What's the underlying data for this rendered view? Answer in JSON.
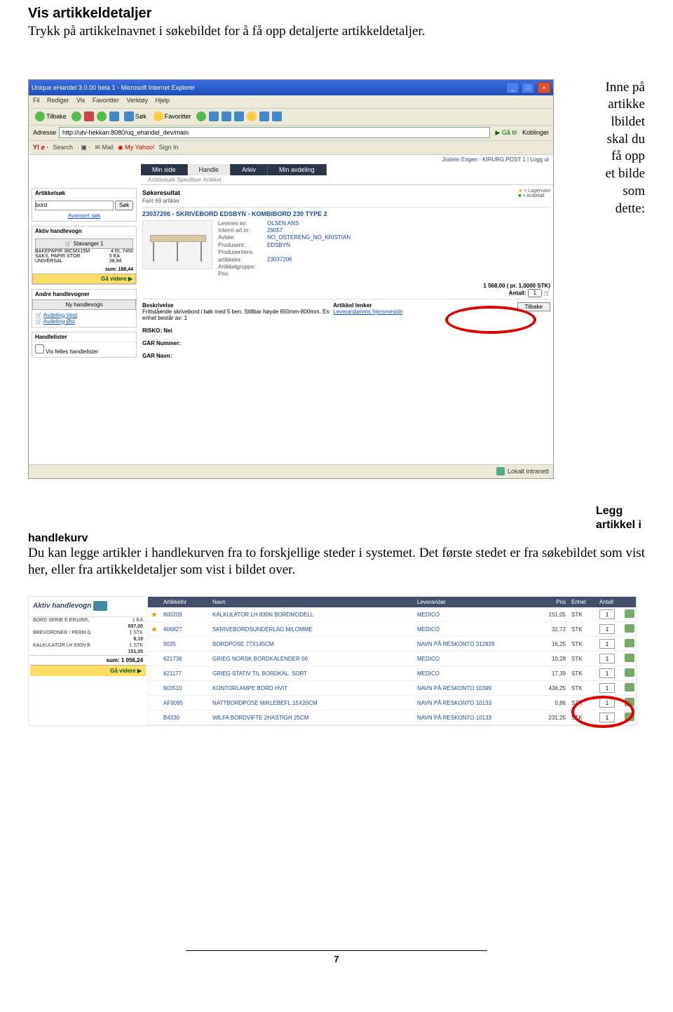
{
  "doc": {
    "h1": "Vis artikkeldetaljer",
    "p1": "Trykk på artikkelnavnet i søkebildet for å få opp detaljerte artikkeldetaljer.",
    "aside1": "Inne på artikke lbildet skal du få opp et bilde som dette:",
    "h2_right": "Legg artikkel i",
    "h2_left": "handlekurv",
    "p2": "Du kan legge artikler i handlekurven fra to forskjellige steder i systemet. Det første stedet er fra søkebildet som vist her, eller fra artikkeldetaljer som vist i bildet over.",
    "page": "7"
  },
  "s1": {
    "title": "Unique eHandel 3.0.00 beta 1 - Microsoft Internet Explorer",
    "menu": [
      "Fil",
      "Rediger",
      "Vis",
      "Favoritter",
      "Verktøy",
      "Hjelp"
    ],
    "tb_back": "Tilbake",
    "tb_sok": "Søk",
    "tb_fav": "Favoritter",
    "addr_label": "Adresse",
    "addr_value": "http://utv-hekkan:8080/uq_ehandel_dev/main",
    "go": "Gå til",
    "koblinger": "Koblinger",
    "ybar": {
      "search": "Search",
      "mail": "Mail",
      "myy": "My Yahoo!",
      "signin": "Sign In"
    },
    "header_right": "Jostein Engen - KIRURG.POST 1 | Logg ut",
    "tabs": [
      "Min side",
      "Handle",
      "Arkiv",
      "Min avdeling"
    ],
    "subtabs": "Artikkelsøk     Spesifiser Artikkel",
    "side": {
      "sok_h": "Artikkelsøk",
      "sok_btn": "Søk",
      "sok_val": "bord",
      "adv": "Avansert søk",
      "cart_h": "Aktiv handlevogn",
      "cart_name": "Stavanger 1",
      "rows": [
        [
          "BAKEPAPIR 38CMX15M",
          "4 RL",
          "7450"
        ],
        [
          "SAKS, PAPIR STOR UNIVERSAL",
          "5 EA",
          "38,94"
        ]
      ],
      "sum": "sum: 188,44",
      "go": "Gå videre ▶",
      "other_h": "Andre handlevogner",
      "new": "Ny handlevogn",
      "dep1": "Avdeling Vest",
      "dep2": "Avdeling Øst",
      "lists_h": "Handlelister",
      "felles": "Vis felles handlelister"
    },
    "res": {
      "h": "Søkeresultat",
      "count": "Fant 69 artikler",
      "leg1": "= Lagervare",
      "leg2": "= Anbefalt",
      "title": "23037206 - SKRIVEBORD EDSBYN - KOMBIBORD 230 TYPE 2",
      "meta": [
        [
          "Leveres av:",
          "OLSEN ANS"
        ],
        [
          "Internt art.nr:",
          "29057"
        ],
        [
          "Avtale:",
          "NO_OSTERENG_NO_KRISTIAN"
        ],
        [
          "Produsent:",
          "EDSBYN"
        ],
        [
          "Produsentens artikkelnr:",
          "23037206"
        ],
        [
          "Artikkelgruppe:",
          ""
        ],
        [
          "Pris:",
          ""
        ]
      ],
      "price": "1 568,00  ( pr. 1,0000 STK)",
      "antall_label": "Antall:",
      "antall_val": "1",
      "d_h1": "Beskrivelse",
      "d_body": "Frittstående skrivebord i bøk med 5 ben. Stillbar høyde 650mm-800mm.\nEn enhet består av: 1",
      "risko": "RISKO: Nei",
      "garnr": "GAR Nummer:",
      "garnavn": "GAR Navn:",
      "d_h2": "Artikkel lenker",
      "d_lnk": "Leverandørens hjemmeside",
      "back": "Tilbake"
    },
    "status": "Lokalt intranett"
  },
  "s2": {
    "left": {
      "h": "Aktiv handlevogn",
      "rows": [
        [
          "BORD SERIE E ER106R,",
          "1 EA",
          "897,00"
        ],
        [
          "BREVORDNER / PERM G",
          "1 STK",
          "8,19"
        ],
        [
          "KALKULATOR LH 830N B",
          "1 STK",
          "151,05"
        ]
      ],
      "sum": "sum: 1 056,24",
      "go": "Gå videre ▶"
    },
    "head": [
      "",
      "Artikkelnr",
      "Navn",
      "Leverandør",
      "Pris",
      "Enhet",
      "Antall",
      ""
    ],
    "rows": [
      {
        "star": true,
        "art": "800209",
        "name": "KALKULATOR LH 830N BORDMODELL",
        "lev": "MEDICO",
        "pris": "151,05",
        "enh": "STK",
        "ant": "1"
      },
      {
        "star": true,
        "art": "406827",
        "name": "SKRIVEBORDSUNDERLAG M/LOMME",
        "lev": "MEDICO",
        "pris": "32,72",
        "enh": "STK",
        "ant": "1"
      },
      {
        "star": false,
        "art": "9035",
        "name": "BORDPOSE 77X145CM",
        "lev": "NAVN PÅ RESKONTO 312939",
        "pris": "16,25",
        "enh": "STK",
        "ant": "1"
      },
      {
        "star": false,
        "art": "621736",
        "name": "GRIEG NORSK BORDKALENDER 06",
        "lev": "MEDICO",
        "pris": "10,28",
        "enh": "STK",
        "ant": "1"
      },
      {
        "star": false,
        "art": "621177",
        "name": "GRIEG STATIV TIL BORDKAL. SORT",
        "lev": "MEDICO",
        "pris": "17,39",
        "enh": "STK",
        "ant": "1"
      },
      {
        "star": false,
        "art": "903510",
        "name": "KONTORLAMPE BORD HVIT",
        "lev": "NAVN PÅ RESKONTO 10399",
        "pris": "436,25",
        "enh": "STK",
        "ant": "1"
      },
      {
        "star": false,
        "art": "AF9095",
        "name": "NATTBORDPOSE M/KLEBEFL.15X20CM",
        "lev": "NAVN PÅ RESKONTO 10133",
        "pris": "0,86",
        "enh": "STK",
        "ant": "1"
      },
      {
        "star": false,
        "art": "B4330",
        "name": "WILFA BORDVIFTE 2HASTIGH 25CM",
        "lev": "NAVN PÅ RESKONTO 10133",
        "pris": "231,25",
        "enh": "STK",
        "ant": "1"
      }
    ]
  }
}
